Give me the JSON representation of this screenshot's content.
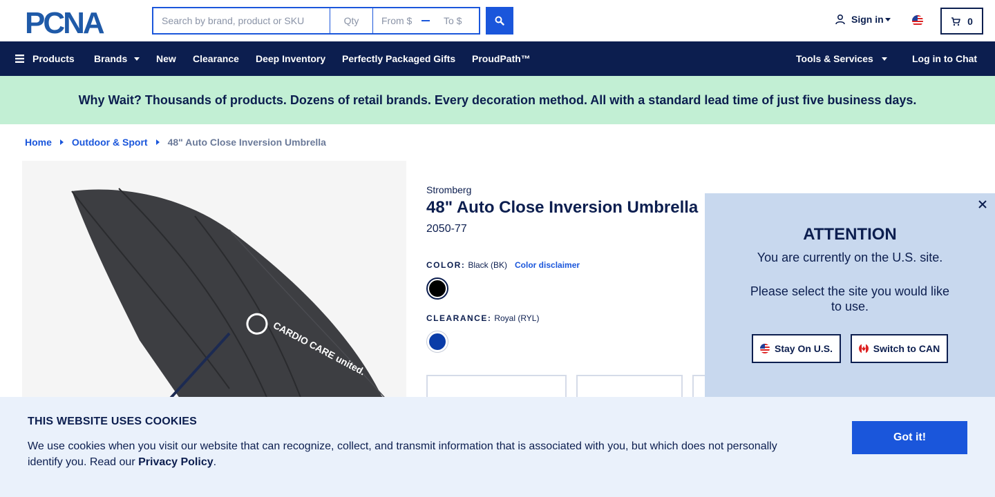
{
  "header": {
    "logo_text": "PCNA",
    "search_placeholder": "Search by brand, product or SKU",
    "qty_placeholder": "Qty",
    "price_from_placeholder": "From $",
    "price_to_placeholder": "To $",
    "signin_label": "Sign in",
    "cart_count": "0"
  },
  "nav": {
    "products": "Products",
    "brands": "Brands",
    "new": "New",
    "clearance": "Clearance",
    "deep_inventory": "Deep Inventory",
    "gifts": "Perfectly Packaged Gifts",
    "proudpath": "ProudPath™",
    "tools": "Tools & Services",
    "chat": "Log in to Chat"
  },
  "promo": {
    "text": "Why Wait? Thousands of products. Dozens of retail brands. Every decoration method. All with a standard lead time of just five business days."
  },
  "breadcrumb": {
    "home": "Home",
    "category": "Outdoor & Sport",
    "current": "48\" Auto Close Inversion Umbrella"
  },
  "product": {
    "image_text": "CARDIO CARE united.",
    "brand": "Stromberg",
    "title": "48\" Auto Close Inversion Umbrella",
    "sku": "2050-77",
    "color_label": "COLOR:",
    "color_value": "Black (BK)",
    "color_disclaimer": "Color disclaimer",
    "clearance_label": "CLEARANCE:",
    "clearance_value": "Royal (RYL)",
    "swatch_black": "#000000",
    "swatch_royal": "#0a3ca8"
  },
  "site_popup": {
    "title": "ATTENTION",
    "line1": "You are currently on the U.S. site.",
    "line2": "Please select the site you would like to use.",
    "stay_label": "Stay On U.S.",
    "switch_label": "Switch to CAN"
  },
  "cookie": {
    "title": "THIS WEBSITE USES COOKIES",
    "text": "We use cookies when you visit our website that can recognize, collect, and transmit information that is associated with you, but which does not personally identify you. Read our ",
    "policy_link": "Privacy Policy",
    "text_end": ".",
    "button": "Got it!"
  },
  "colors": {
    "navy": "#0c1e4f",
    "accent_blue": "#1a56db",
    "promo_green": "#c2efd4",
    "popup_bg": "#c8d8ee",
    "cookie_bg": "#eaf1fb"
  }
}
